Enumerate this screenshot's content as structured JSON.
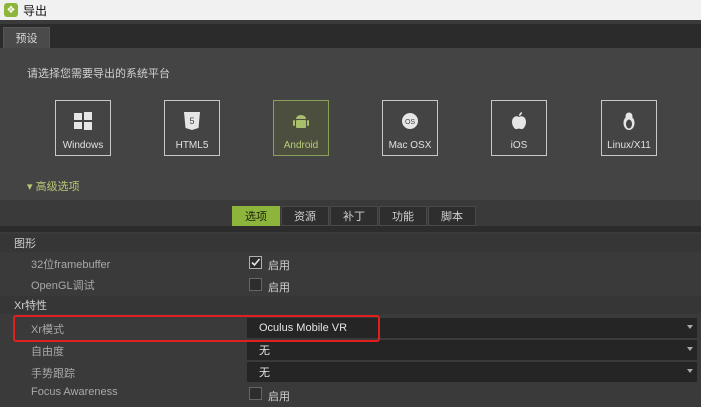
{
  "window": {
    "title": "导出",
    "icon": "app-icon"
  },
  "tabs": {
    "preset": "预设"
  },
  "platform_section": {
    "prompt": "请选择您需要导出的系统平台",
    "platforms": [
      {
        "label": "Windows",
        "icon": "windows-icon",
        "selected": false
      },
      {
        "label": "HTML5",
        "icon": "html5-icon",
        "selected": false
      },
      {
        "label": "Android",
        "icon": "android-icon",
        "selected": true
      },
      {
        "label": "Mac OSX",
        "icon": "mac-os-icon",
        "selected": false
      },
      {
        "label": "iOS",
        "icon": "apple-icon",
        "selected": false
      },
      {
        "label": "Linux/X11",
        "icon": "linux-icon",
        "selected": false
      }
    ],
    "advanced": "▾ 高级选项"
  },
  "subtabs": [
    {
      "label": "选项",
      "active": true
    },
    {
      "label": "资源",
      "active": false
    },
    {
      "label": "补丁",
      "active": false
    },
    {
      "label": "功能",
      "active": false
    },
    {
      "label": "脚本",
      "active": false
    }
  ],
  "graphics": {
    "header": "图形",
    "framebuffer": {
      "label": "32位framebuffer",
      "checked": true,
      "check_label": "启用"
    },
    "opengl_debug": {
      "label": "OpenGL调试",
      "checked": false,
      "check_label": "启用"
    }
  },
  "xr": {
    "header": "Xr特性",
    "mode": {
      "label": "Xr模式",
      "value": "Oculus Mobile VR"
    },
    "dof": {
      "label": "自由度",
      "value": "无"
    },
    "hand_tracking": {
      "label": "手势跟踪",
      "value": "无"
    },
    "focus_awareness": {
      "label": "Focus Awareness",
      "checked": false,
      "check_label": "启用"
    }
  },
  "colors": {
    "accent": "#8db53b",
    "highlight": "#e0201f"
  }
}
